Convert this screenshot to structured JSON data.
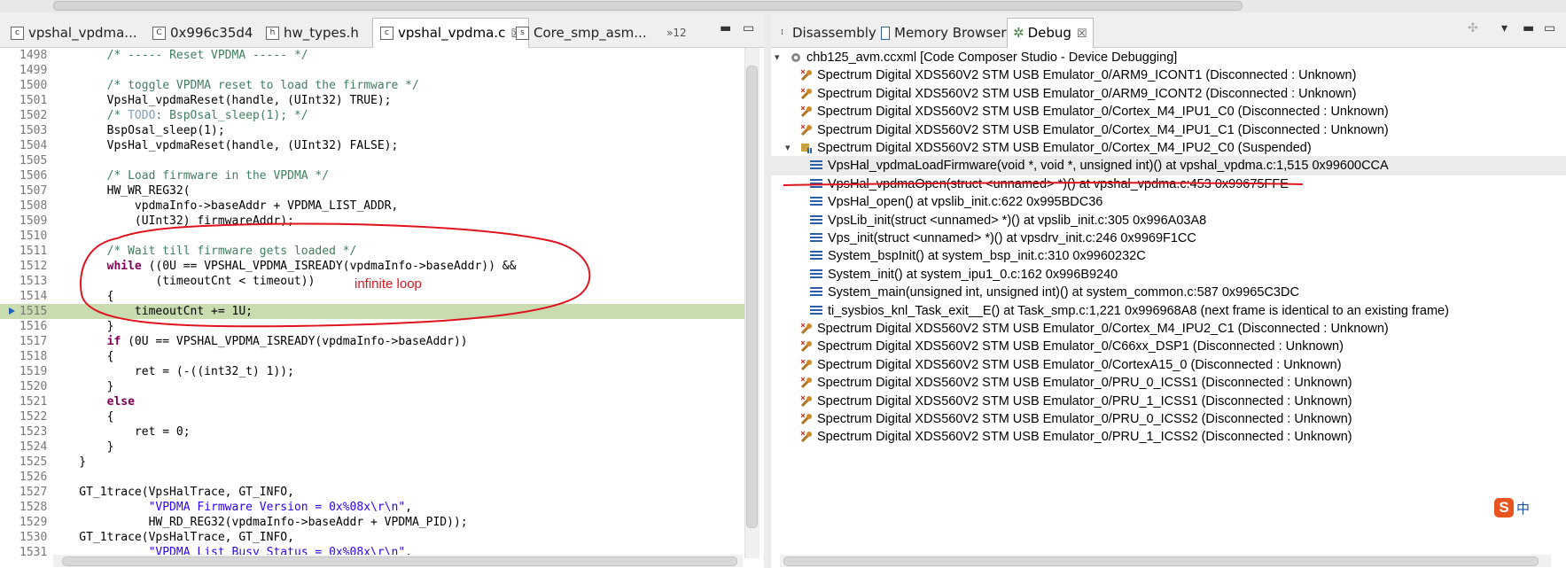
{
  "editor": {
    "tabs": [
      {
        "label": "vpshal_vpdma...",
        "active": false
      },
      {
        "label": "0x996c35d4",
        "active": false,
        "icon": "C"
      },
      {
        "label": "hw_types.h",
        "active": false
      },
      {
        "label": "vpshal_vpdma.c",
        "active": true
      },
      {
        "label": "Core_smp_asm...",
        "active": false
      }
    ],
    "overflow_label": "»12",
    "minimize_symbol": "▬",
    "maximize_symbol": "▭",
    "close_symbol": "☒",
    "current_line": "1515",
    "code_lines": [
      {
        "n": "1498",
        "parts": [
          [
            "",
            "        "
          ],
          [
            "comment",
            "/* ----- Reset VPDMA ----- */"
          ]
        ]
      },
      {
        "n": "1499",
        "parts": [
          [
            "",
            ""
          ]
        ]
      },
      {
        "n": "1500",
        "parts": [
          [
            "",
            "        "
          ],
          [
            "comment",
            "/* toggle VPDMA reset to load the firmware */"
          ]
        ]
      },
      {
        "n": "1501",
        "parts": [
          [
            "",
            "        VpsHal_vpdmaReset(handle, (UInt32) TRUE);"
          ]
        ]
      },
      {
        "n": "1502",
        "parts": [
          [
            "",
            "        "
          ],
          [
            "comment",
            "/* "
          ],
          [
            "todo",
            "TODO"
          ],
          [
            "comment",
            ": BspOsal_sleep(1); */"
          ]
        ]
      },
      {
        "n": "1503",
        "parts": [
          [
            "",
            "        BspOsal_sleep(1);"
          ]
        ]
      },
      {
        "n": "1504",
        "parts": [
          [
            "",
            "        VpsHal_vpdmaReset(handle, (UInt32) FALSE);"
          ]
        ]
      },
      {
        "n": "1505",
        "parts": [
          [
            "",
            ""
          ]
        ]
      },
      {
        "n": "1506",
        "parts": [
          [
            "",
            "        "
          ],
          [
            "comment",
            "/* Load firmware in the VPDMA */"
          ]
        ]
      },
      {
        "n": "1507",
        "parts": [
          [
            "",
            "        HW_WR_REG32("
          ]
        ]
      },
      {
        "n": "1508",
        "parts": [
          [
            "",
            "            vpdmaInfo->baseAddr + VPDMA_LIST_ADDR,"
          ]
        ]
      },
      {
        "n": "1509",
        "parts": [
          [
            "",
            "            (UInt32) firmwareAddr);"
          ]
        ]
      },
      {
        "n": "1510",
        "parts": [
          [
            "",
            ""
          ]
        ]
      },
      {
        "n": "1511",
        "parts": [
          [
            "",
            "        "
          ],
          [
            "comment",
            "/* Wait till firmware gets loaded */"
          ]
        ]
      },
      {
        "n": "1512",
        "parts": [
          [
            "",
            "        "
          ],
          [
            "kw",
            "while"
          ],
          [
            "",
            " ((0U == VPSHAL_VPDMA_ISREADY(vpdmaInfo->baseAddr)) &&"
          ]
        ]
      },
      {
        "n": "1513",
        "parts": [
          [
            "",
            "               (timeoutCnt < timeout))"
          ]
        ]
      },
      {
        "n": "1514",
        "parts": [
          [
            "",
            "        {"
          ]
        ]
      },
      {
        "n": "1515",
        "parts": [
          [
            "",
            "            timeoutCnt += 1U;"
          ]
        ]
      },
      {
        "n": "1516",
        "parts": [
          [
            "",
            "        }"
          ]
        ]
      },
      {
        "n": "1517",
        "parts": [
          [
            "",
            "        "
          ],
          [
            "kw",
            "if"
          ],
          [
            "",
            " (0U == VPSHAL_VPDMA_ISREADY(vpdmaInfo->baseAddr))"
          ]
        ]
      },
      {
        "n": "1518",
        "parts": [
          [
            "",
            "        {"
          ]
        ]
      },
      {
        "n": "1519",
        "parts": [
          [
            "",
            "            ret = (-((int32_t) 1));"
          ]
        ]
      },
      {
        "n": "1520",
        "parts": [
          [
            "",
            "        }"
          ]
        ]
      },
      {
        "n": "1521",
        "parts": [
          [
            "",
            "        "
          ],
          [
            "kw",
            "else"
          ]
        ]
      },
      {
        "n": "1522",
        "parts": [
          [
            "",
            "        {"
          ]
        ]
      },
      {
        "n": "1523",
        "parts": [
          [
            "",
            "            ret = 0;"
          ]
        ]
      },
      {
        "n": "1524",
        "parts": [
          [
            "",
            "        }"
          ]
        ]
      },
      {
        "n": "1525",
        "parts": [
          [
            "",
            "    }"
          ]
        ]
      },
      {
        "n": "1526",
        "parts": [
          [
            "",
            ""
          ]
        ]
      },
      {
        "n": "1527",
        "parts": [
          [
            "",
            "    GT_1trace(VpsHalTrace, GT_INFO,"
          ]
        ]
      },
      {
        "n": "1528",
        "parts": [
          [
            "",
            "              "
          ],
          [
            "str",
            "\"VPDMA Firmware Version = 0x%08x\\r\\n\""
          ],
          [
            "",
            ","
          ]
        ]
      },
      {
        "n": "1529",
        "parts": [
          [
            "",
            "              HW_RD_REG32(vpdmaInfo->baseAddr + VPDMA_PID));"
          ]
        ]
      },
      {
        "n": "1530",
        "parts": [
          [
            "",
            "    GT_1trace(VpsHalTrace, GT_INFO,"
          ]
        ]
      },
      {
        "n": "1531",
        "parts": [
          [
            "",
            "              "
          ],
          [
            "str",
            "\"VPDMA List Busy Status = 0x%08x\\r\\n\""
          ],
          [
            "",
            ","
          ]
        ]
      }
    ],
    "annotation": "infinite loop",
    "annotation_color": "#e0141e"
  },
  "debug": {
    "tabs": [
      {
        "label": "Disassembly",
        "active": false
      },
      {
        "label": "Memory Browser",
        "active": false
      },
      {
        "label": "Debug",
        "active": true
      }
    ],
    "tab_close_symbol": "☒",
    "view_menu_symbol": "▾",
    "minimize_symbol": "▬",
    "maximize_symbol": "▭",
    "tree": [
      {
        "indent": 0,
        "toggle": "▾",
        "icon": "session-icon",
        "label": "chb125_avm.ccxml [Code Composer Studio - Device Debugging]"
      },
      {
        "indent": 1,
        "toggle": "",
        "icon": "disconnected-core-icon",
        "label": "Spectrum Digital XDS560V2 STM USB Emulator_0/ARM9_ICONT1 (Disconnected : Unknown)"
      },
      {
        "indent": 1,
        "toggle": "",
        "icon": "disconnected-core-icon",
        "label": "Spectrum Digital XDS560V2 STM USB Emulator_0/ARM9_ICONT2 (Disconnected : Unknown)"
      },
      {
        "indent": 1,
        "toggle": "",
        "icon": "disconnected-core-icon",
        "label": "Spectrum Digital XDS560V2 STM USB Emulator_0/Cortex_M4_IPU1_C0 (Disconnected : Unknown)"
      },
      {
        "indent": 1,
        "toggle": "",
        "icon": "disconnected-core-icon",
        "label": "Spectrum Digital XDS560V2 STM USB Emulator_0/Cortex_M4_IPU1_C1 (Disconnected : Unknown)"
      },
      {
        "indent": 1,
        "toggle": "▾",
        "icon": "suspended-core-icon",
        "label": "Spectrum Digital XDS560V2 STM USB Emulator_0/Cortex_M4_IPU2_C0 (Suspended)"
      },
      {
        "indent": 2,
        "toggle": "",
        "icon": "stack-frame-icon",
        "label": "VpsHal_vpdmaLoadFirmware(void *, void *, unsigned int)() at vpshal_vpdma.c:1,515 0x99600CCA",
        "selected": true
      },
      {
        "indent": 2,
        "toggle": "",
        "icon": "stack-frame-icon",
        "label": "VpsHal_vpdmaOpen(struct <unnamed> *)() at vpshal_vpdma.c:453 0x99675FFE"
      },
      {
        "indent": 2,
        "toggle": "",
        "icon": "stack-frame-icon",
        "label": "VpsHal_open() at vpslib_init.c:622 0x995BDC36"
      },
      {
        "indent": 2,
        "toggle": "",
        "icon": "stack-frame-icon",
        "label": "VpsLib_init(struct <unnamed> *)() at vpslib_init.c:305 0x996A03A8"
      },
      {
        "indent": 2,
        "toggle": "",
        "icon": "stack-frame-icon",
        "label": "Vps_init(struct <unnamed> *)() at vpsdrv_init.c:246 0x9969F1CC"
      },
      {
        "indent": 2,
        "toggle": "",
        "icon": "stack-frame-icon",
        "label": "System_bspInit() at system_bsp_init.c:310 0x9960232C"
      },
      {
        "indent": 2,
        "toggle": "",
        "icon": "stack-frame-icon",
        "label": "System_init() at system_ipu1_0.c:162 0x996B9240"
      },
      {
        "indent": 2,
        "toggle": "",
        "icon": "stack-frame-icon",
        "label": "System_main(unsigned int, unsigned int)() at system_common.c:587 0x9965C3DC"
      },
      {
        "indent": 2,
        "toggle": "",
        "icon": "stack-frame-icon",
        "label": "ti_sysbios_knl_Task_exit__E() at Task_smp.c:1,221 0x996968A8  (next frame is identical to an existing frame)"
      },
      {
        "indent": 1,
        "toggle": "",
        "icon": "disconnected-core-icon",
        "label": "Spectrum Digital XDS560V2 STM USB Emulator_0/Cortex_M4_IPU2_C1 (Disconnected : Unknown)"
      },
      {
        "indent": 1,
        "toggle": "",
        "icon": "disconnected-core-icon",
        "label": "Spectrum Digital XDS560V2 STM USB Emulator_0/C66xx_DSP1 (Disconnected : Unknown)"
      },
      {
        "indent": 1,
        "toggle": "",
        "icon": "disconnected-core-icon",
        "label": "Spectrum Digital XDS560V2 STM USB Emulator_0/CortexA15_0 (Disconnected : Unknown)"
      },
      {
        "indent": 1,
        "toggle": "",
        "icon": "disconnected-core-icon",
        "label": "Spectrum Digital XDS560V2 STM USB Emulator_0/PRU_0_ICSS1 (Disconnected : Unknown)"
      },
      {
        "indent": 1,
        "toggle": "",
        "icon": "disconnected-core-icon",
        "label": "Spectrum Digital XDS560V2 STM USB Emulator_0/PRU_1_ICSS1 (Disconnected : Unknown)"
      },
      {
        "indent": 1,
        "toggle": "",
        "icon": "disconnected-core-icon",
        "label": "Spectrum Digital XDS560V2 STM USB Emulator_0/PRU_0_ICSS2 (Disconnected : Unknown)"
      },
      {
        "indent": 1,
        "toggle": "",
        "icon": "disconnected-core-icon",
        "label": "Spectrum Digital XDS560V2 STM USB Emulator_0/PRU_1_ICSS2 (Disconnected : Unknown)"
      }
    ],
    "ime_label": "中",
    "ime_brand_letter": "S"
  },
  "colors": {
    "annotation_red": "#e0141e",
    "current_line_highlight": "#c8dcb0",
    "comment_green": "#3f7f5f",
    "keyword_purple": "#7f0055",
    "string_blue": "#2a00ff",
    "frame_icon_blue": "#2b5fa8"
  }
}
